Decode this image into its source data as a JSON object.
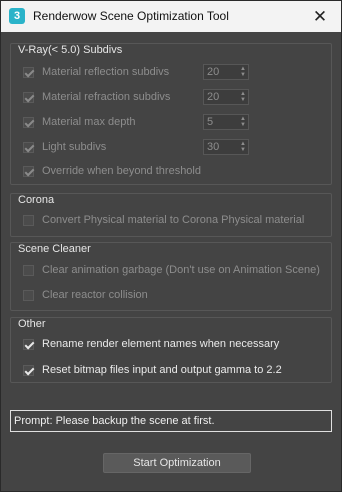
{
  "window": {
    "app_icon_glyph": "3",
    "title": "Renderwow Scene Optimization Tool",
    "close_glyph": "✕"
  },
  "vray": {
    "title": "V-Ray(< 5.0) Subdivs",
    "items": [
      {
        "label": "Material reflection subdivs",
        "value": "20",
        "checked": true,
        "enabled": false
      },
      {
        "label": "Material refraction subdivs",
        "value": "20",
        "checked": true,
        "enabled": false
      },
      {
        "label": "Material max depth",
        "value": "5",
        "checked": true,
        "enabled": false
      },
      {
        "label": "Light subdivs",
        "value": "30",
        "checked": true,
        "enabled": false
      }
    ],
    "override": {
      "label": "Override when beyond threshold",
      "checked": true,
      "enabled": false
    }
  },
  "corona": {
    "title": "Corona",
    "items": [
      {
        "label": "Convert Physical material to Corona Physical material",
        "checked": false,
        "enabled": false
      }
    ]
  },
  "cleaner": {
    "title": "Scene Cleaner",
    "items": [
      {
        "label": "Clear animation garbage (Don't use on Animation Scene)",
        "checked": false,
        "enabled": false
      },
      {
        "label": "Clear reactor collision",
        "checked": false,
        "enabled": false
      }
    ]
  },
  "other": {
    "title": "Other",
    "items": [
      {
        "label": "Rename render element names when necessary",
        "checked": true,
        "enabled": true
      },
      {
        "label": "Reset bitmap files input and output gamma to 2.2",
        "checked": true,
        "enabled": true
      }
    ]
  },
  "prompt": {
    "text": "Prompt: Please backup the scene at first."
  },
  "start_button": {
    "label": "Start Optimization"
  }
}
